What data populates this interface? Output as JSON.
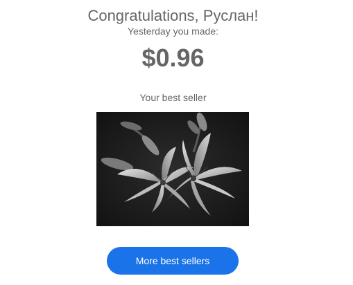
{
  "greeting": "Congratulations, Руслан!",
  "subtext": "Yesterday you made:",
  "amount": "$0.96",
  "best_seller_label": "Your best seller",
  "product_image": {
    "description_icon": "lily-flower-photo"
  },
  "cta": {
    "label": "More best sellers"
  },
  "colors": {
    "text": "#666666",
    "button_bg": "#1a73e8",
    "button_text": "#ffffff"
  }
}
